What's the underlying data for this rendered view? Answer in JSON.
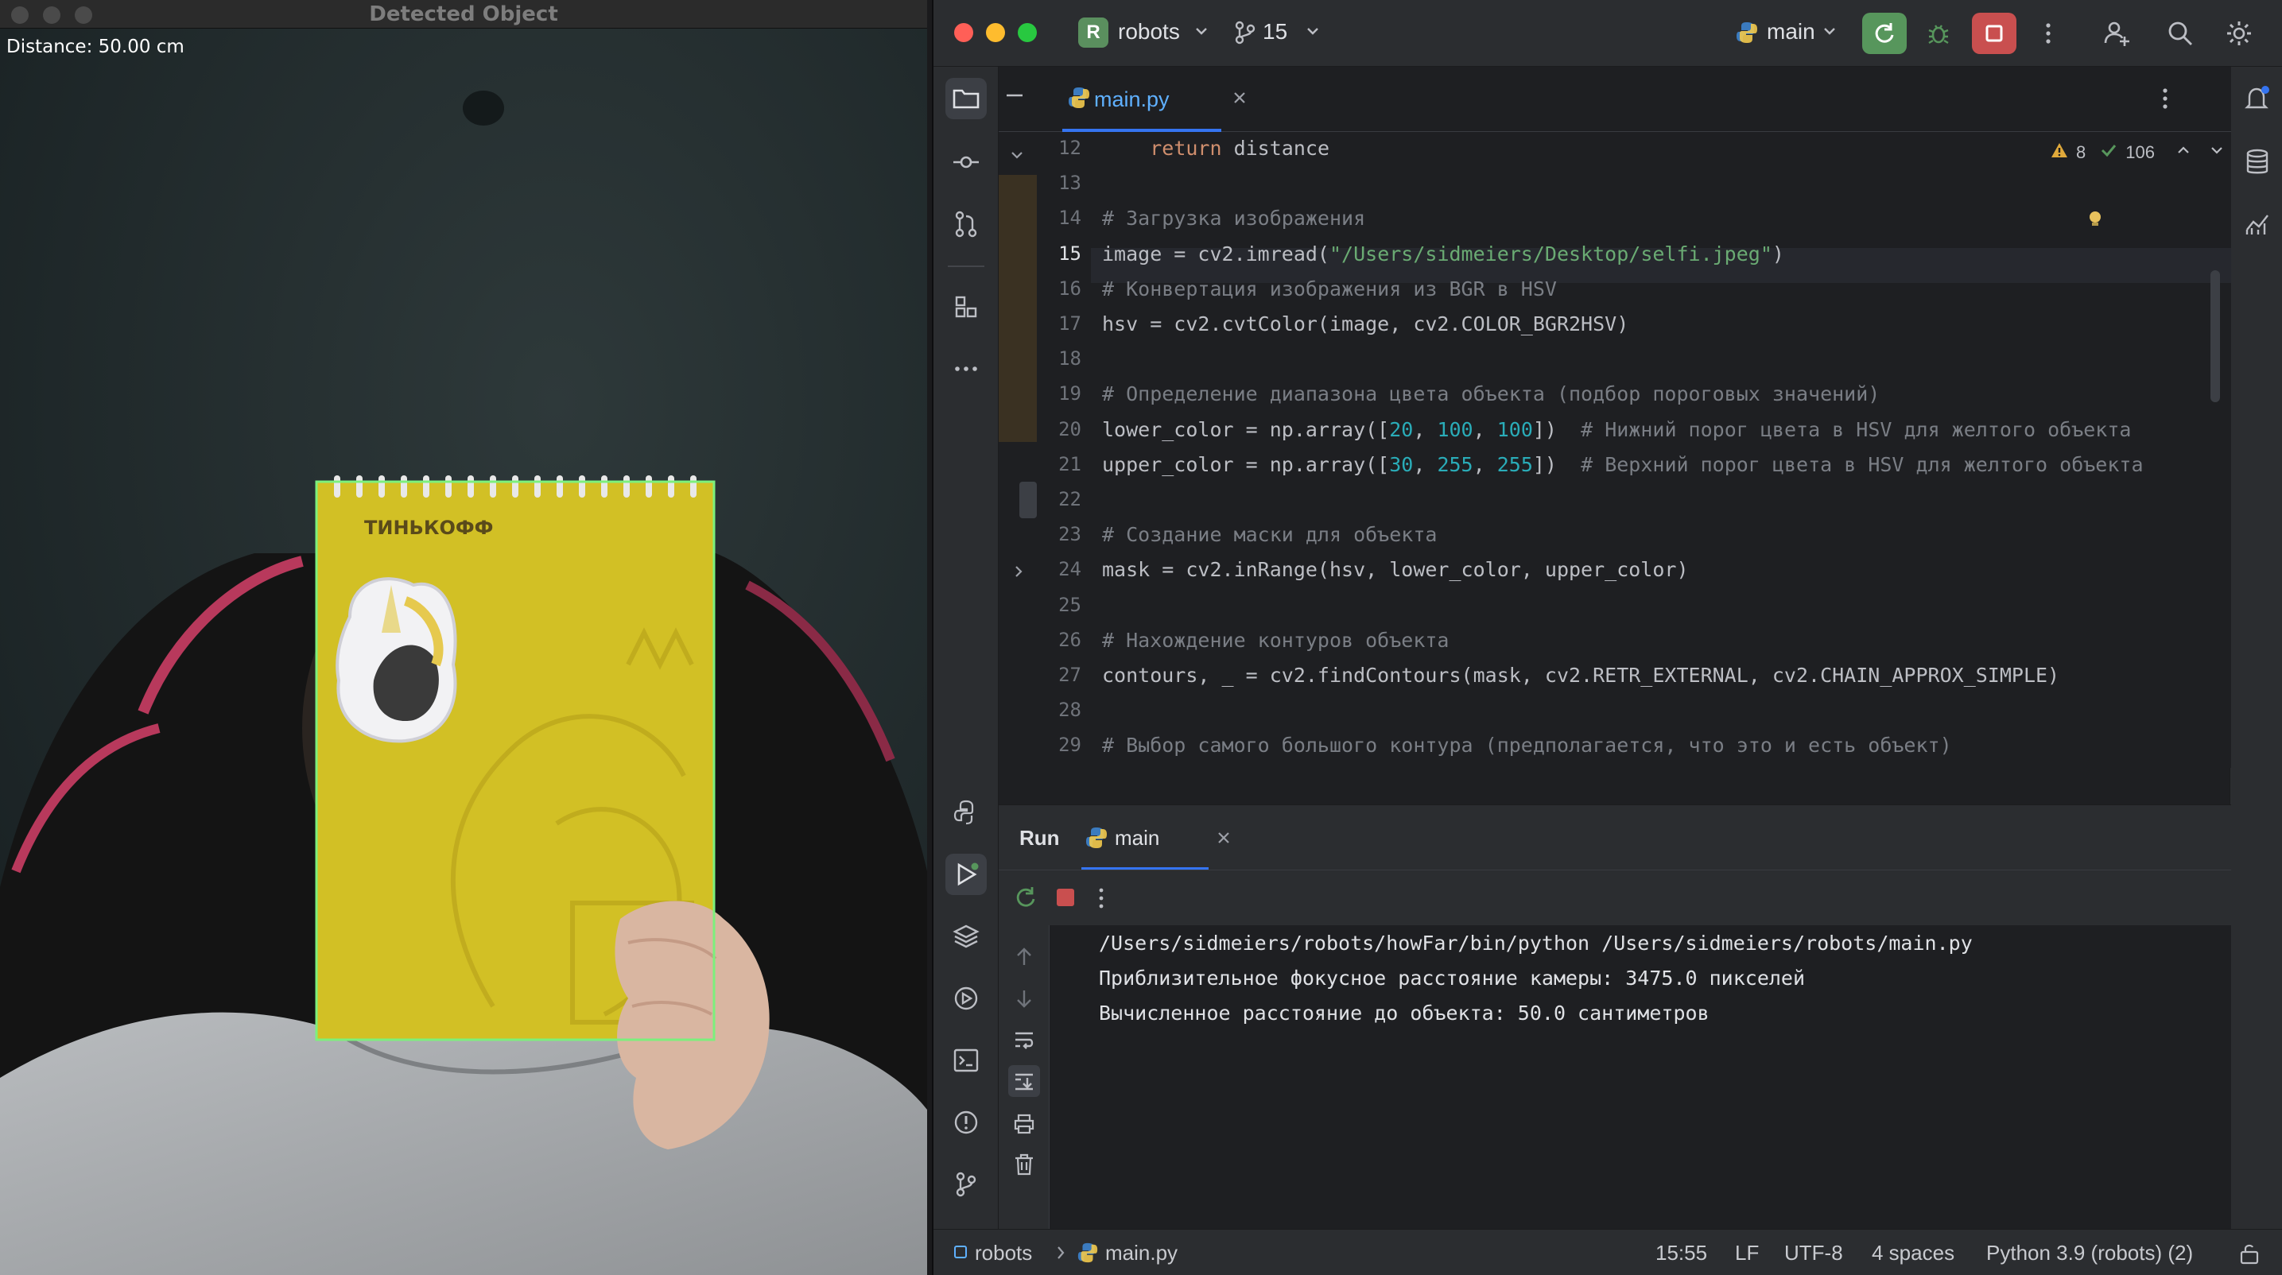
{
  "camera_window": {
    "title": "Detected Object",
    "overlay": "Distance: 50.00 cm",
    "notebook_brand": "ТИНЬКОФФ"
  },
  "ide": {
    "project_badge": "R",
    "project_name": "robots",
    "vcs_count": "15",
    "run_config": "main",
    "colors": {
      "accent": "#3574f0",
      "run_green": "#57965c",
      "stop_red": "#c94f4f",
      "keyword": "#cf8e6d",
      "string": "#6aab73",
      "number": "#2aacb8",
      "comment": "#7a7e85"
    },
    "editor": {
      "tab_label": "main.py",
      "inspection": {
        "warnings": "8",
        "ok": "106"
      },
      "current_line": "15",
      "lines": [
        {
          "n": "12",
          "parts": [
            {
              "t": "    ",
              "c": ""
            },
            {
              "t": "return",
              "c": "kw"
            },
            {
              "t": " distance",
              "c": ""
            }
          ]
        },
        {
          "n": "13",
          "parts": []
        },
        {
          "n": "14",
          "parts": [
            {
              "t": "# Загрузка изображения",
              "c": "cm"
            }
          ]
        },
        {
          "n": "15",
          "parts": [
            {
              "t": "image = cv2.imread(",
              "c": ""
            },
            {
              "t": "\"/Users/sidmeiers/Desktop/selfi.jpeg\"",
              "c": "str"
            },
            {
              "t": ")",
              "c": ""
            }
          ]
        },
        {
          "n": "16",
          "parts": [
            {
              "t": "# Конвертация изображения из BGR в HSV",
              "c": "cm"
            }
          ]
        },
        {
          "n": "17",
          "parts": [
            {
              "t": "hsv = cv2.cvtColor(image, cv2.COLOR_BGR2HSV)",
              "c": ""
            }
          ]
        },
        {
          "n": "18",
          "parts": []
        },
        {
          "n": "19",
          "parts": [
            {
              "t": "# Определение диапазона цвета объекта (подбор пороговых значений)",
              "c": "cm"
            }
          ]
        },
        {
          "n": "20",
          "parts": [
            {
              "t": "lower_color = np.array([",
              "c": ""
            },
            {
              "t": "20",
              "c": "num"
            },
            {
              "t": ", ",
              "c": ""
            },
            {
              "t": "100",
              "c": "num"
            },
            {
              "t": ", ",
              "c": ""
            },
            {
              "t": "100",
              "c": "num"
            },
            {
              "t": "])  ",
              "c": ""
            },
            {
              "t": "# Нижний порог цвета в HSV для желтого объекта",
              "c": "cm"
            }
          ]
        },
        {
          "n": "21",
          "parts": [
            {
              "t": "upper_color = np.array([",
              "c": ""
            },
            {
              "t": "30",
              "c": "num"
            },
            {
              "t": ", ",
              "c": ""
            },
            {
              "t": "255",
              "c": "num"
            },
            {
              "t": ", ",
              "c": ""
            },
            {
              "t": "255",
              "c": "num"
            },
            {
              "t": "])  ",
              "c": ""
            },
            {
              "t": "# Верхний порог цвета в HSV для желтого объекта",
              "c": "cm"
            }
          ]
        },
        {
          "n": "22",
          "parts": []
        },
        {
          "n": "23",
          "parts": [
            {
              "t": "# Создание маски для объекта",
              "c": "cm"
            }
          ]
        },
        {
          "n": "24",
          "parts": [
            {
              "t": "mask = cv2.inRange(hsv, lower_color, upper_color)",
              "c": ""
            }
          ]
        },
        {
          "n": "25",
          "parts": []
        },
        {
          "n": "26",
          "parts": [
            {
              "t": "# Нахождение контуров объекта",
              "c": "cm"
            }
          ]
        },
        {
          "n": "27",
          "parts": [
            {
              "t": "contours, _ = cv2.findContours(mask, cv2.RETR_EXTERNAL, cv2.CHAIN_APPROX_SIMPLE)",
              "c": ""
            }
          ]
        },
        {
          "n": "28",
          "parts": []
        },
        {
          "n": "29",
          "parts": [
            {
              "t": "# Выбор самого большого контура (предполагается, что это и есть объект)",
              "c": "cm"
            }
          ]
        }
      ]
    },
    "run_panel": {
      "title": "Run",
      "tab_label": "main",
      "output": [
        "/Users/sidmeiers/robots/howFar/bin/python /Users/sidmeiers/robots/main.py",
        "Приблизительное фокусное расстояние камеры: 3475.0 пикселей",
        "Вычисленное расстояние до объекта: 50.0 сантиметров"
      ]
    },
    "status_bar": {
      "project": "robots",
      "file": "main.py",
      "position": "15:55",
      "line_sep": "LF",
      "encoding": "UTF-8",
      "indent": "4 spaces",
      "interpreter": "Python 3.9 (robots) (2)"
    }
  }
}
